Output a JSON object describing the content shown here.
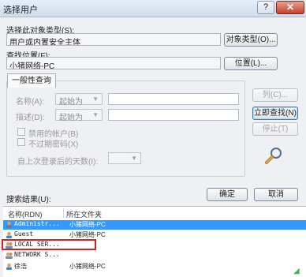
{
  "window": {
    "title": "选择用户",
    "help_label": "?",
    "close_label": "✕"
  },
  "object_type": {
    "label": "选择此对象类型(S):",
    "value": "用户或内置安全主体",
    "button": "对象类型(O)..."
  },
  "location": {
    "label": "查找位置(F):",
    "value": "小猪网络-PC",
    "button": "位置(L)..."
  },
  "general_query": {
    "tab_label": "一般性查询",
    "name_label": "名称(A):",
    "name_mode": "起始为",
    "description_label": "描述(D):",
    "description_mode": "起始为",
    "disabled_accounts_label": "禁用的帐户(B)",
    "non_expiring_password_label": "不过期密码(X)",
    "days_since_logon_label": "自上次登录后的天数(I):"
  },
  "side_buttons": {
    "columns": "列(C)...",
    "find_now": "立即查找(N)",
    "stop": "停止(T)"
  },
  "footer": {
    "ok": "确定",
    "cancel": "取消"
  },
  "results": {
    "label": "搜索结果(U):",
    "columns": [
      "名称(RDN)",
      "所在文件夹"
    ],
    "rows": [
      {
        "name": "Administr...",
        "folder": "小猪网络-PC",
        "selected": true
      },
      {
        "name": "Guest",
        "folder": "小猪网络-PC",
        "selected": false
      },
      {
        "name": "LOCAL SER...",
        "folder": "",
        "selected": false
      },
      {
        "name": "NETWORK S...",
        "folder": "",
        "selected": false
      },
      {
        "name": "徐浩",
        "folder": "小猪网络-PC",
        "selected": false
      }
    ]
  },
  "colors": {
    "selection": "#3399ff",
    "annotation_box": "#d42222"
  }
}
